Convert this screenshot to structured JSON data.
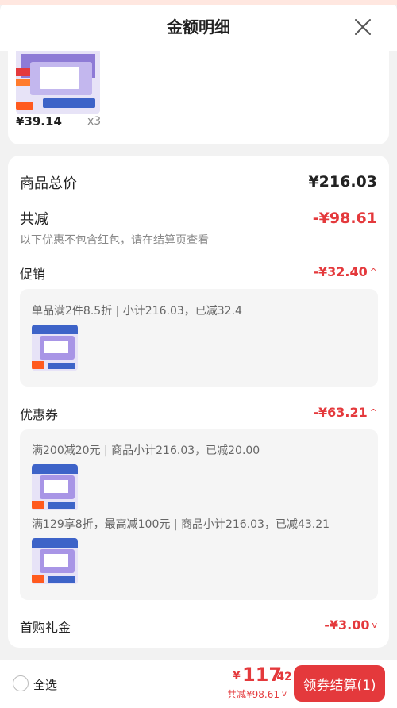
{
  "header": {
    "title": "金额明细"
  },
  "product": {
    "price": "¥39.14",
    "qty": "x3"
  },
  "summary": {
    "total_label": "商品总价",
    "total_value": "¥216.03",
    "reduce_label": "共减",
    "reduce_value": "-¥98.61",
    "note": "以下优惠不包含红包，请在结算页查看"
  },
  "promotion": {
    "label": "促销",
    "amount": "-¥32.40",
    "chevron": "^",
    "detail": "单品满2件8.5折 | 小计216.03，已减32.4"
  },
  "coupon": {
    "label": "优惠券",
    "amount": "-¥63.21",
    "chevron": "^",
    "items": [
      {
        "text": "满200减20元 | 商品小计216.03，已减20.00"
      },
      {
        "text": "满129享8折，最高减100元 | 商品小计216.03，已减43.21"
      }
    ]
  },
  "first_purchase": {
    "label": "首购礼金",
    "amount": "-¥3.00",
    "chevron": "v"
  },
  "bottom": {
    "select_all": "全选",
    "currency": "¥",
    "total_int": "117",
    "total_dec": ".42",
    "reduce_text": "共减¥98.61",
    "chevron": "v",
    "checkout_label": "领券结算(1)"
  },
  "colors": {
    "accent": "#e4393c",
    "thumb_purple": "#8e7bd6"
  },
  "icons": {
    "close": "close-icon",
    "radio": "radio-unchecked-icon"
  }
}
